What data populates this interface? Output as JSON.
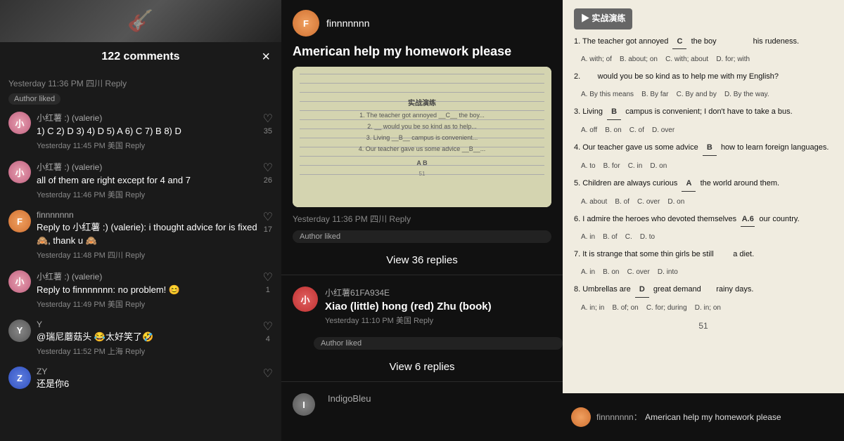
{
  "left": {
    "comments_count": "122 comments",
    "timestamp_header": "Yesterday 11:36 PM 四川 Reply",
    "author_liked": "Author liked",
    "close_btn": "×",
    "comments": [
      {
        "username": "小红薯 :) (valerie)",
        "text": "1) C 2) D 3) 4) D 5) A 6) C 7) B 8) D",
        "meta": "Yesterday 11:45 PM 美国 Reply",
        "likes": "35",
        "avatar_letter": "小"
      },
      {
        "username": "小红薯 :) (valerie)",
        "text": "all of them are right except for 4 and 7",
        "meta": "Yesterday 11:46 PM 美国 Reply",
        "likes": "26",
        "avatar_letter": "小"
      },
      {
        "username": "finnnnnnn",
        "text": "Reply to 小红薯 :) (valerie): i thought advice for is fixed🙈, thank u 🙈",
        "meta": "Yesterday 11:48 PM 四川 Reply",
        "likes": "17",
        "avatar_letter": "F"
      },
      {
        "username": "小红薯 :) (valerie)",
        "text": "Reply to finnnnnnn: no problem! 😊",
        "meta": "Yesterday 11:49 PM 美国 Reply",
        "likes": "1",
        "avatar_letter": "小"
      },
      {
        "username": "Y",
        "text": "@瑞尼蘑菇头 😂太好笑了🤣",
        "meta": "Yesterday 11:52 PM 上海 Reply",
        "likes": "4",
        "avatar_letter": "Y"
      },
      {
        "username": "ZY",
        "text": "还是你6",
        "meta": "",
        "likes": "",
        "avatar_letter": "Z"
      }
    ]
  },
  "middle": {
    "post_username": "finnnnnnn",
    "post_title": "American help my homework please",
    "post_timestamp": "Yesterday 11:36 PM 四川 Reply",
    "author_liked": "Author liked",
    "view_replies_1": "View 36 replies",
    "second_comment_username": "小红薯61FA934E",
    "second_comment_text": "Xiao (little) hong (red) Zhu (book)",
    "second_comment_meta": "Yesterday 11:10 PM 美国 Reply",
    "second_author_liked": "Author liked",
    "view_replies_2": "View 6 replies",
    "third_username": "IndigoBleu"
  },
  "right": {
    "header": "▶ 实战演练",
    "questions": [
      {
        "num": "1.",
        "text": "The teacher got annoyed",
        "blank": "C",
        "rest": "the boy",
        "suffix": "his rudeness.",
        "options": [
          "A. with; of",
          "B. about; on",
          "C. with; about",
          "D. for; with"
        ]
      },
      {
        "num": "2.",
        "text": "",
        "blank": "",
        "rest": "would you be so kind as to help me with my English?",
        "suffix": "",
        "options": [
          "A. By this means",
          "B. By far",
          "C. By and by",
          "D. By the way"
        ]
      },
      {
        "num": "3.",
        "text": "Living",
        "blank": "B",
        "rest": "campus is convenient; I don't have to take a bus.",
        "suffix": "",
        "options": [
          "A. off",
          "B. on",
          "C. of",
          "D. over"
        ]
      },
      {
        "num": "4.",
        "text": "Our teacher gave us some advice",
        "blank": "B",
        "rest": "how to learn foreign languages.",
        "suffix": "",
        "options": [
          "A. to",
          "B. for",
          "C. in",
          "D. on"
        ]
      },
      {
        "num": "5.",
        "text": "Children are always curious",
        "blank": "A",
        "rest": "the world around them.",
        "suffix": "",
        "options": [
          "A. about",
          "B. of",
          "C. over",
          "D. on"
        ]
      },
      {
        "num": "6.",
        "text": "I admire the heroes who devoted themselves",
        "blank": "A. 6",
        "rest": "our country.",
        "suffix": "",
        "options": [
          "A. in",
          "B. of",
          "C.",
          "D. to"
        ]
      },
      {
        "num": "7.",
        "text": "It is strange that some thin girls be still",
        "blank": "",
        "rest": "a diet.",
        "suffix": "",
        "options": [
          "A. in",
          "B. on",
          "C. over",
          "D. into"
        ]
      },
      {
        "num": "8.",
        "text": "Umbrellas are",
        "blank": "D",
        "rest": "great demand",
        "suffix": "rainy days.",
        "options": [
          "A. in; in",
          "B. of; on",
          "C. for; during",
          "D. in; on"
        ]
      }
    ],
    "page_number": "51",
    "bottom_bar": {
      "username": "finnnnnnn：",
      "text": "American help my homework please"
    }
  }
}
